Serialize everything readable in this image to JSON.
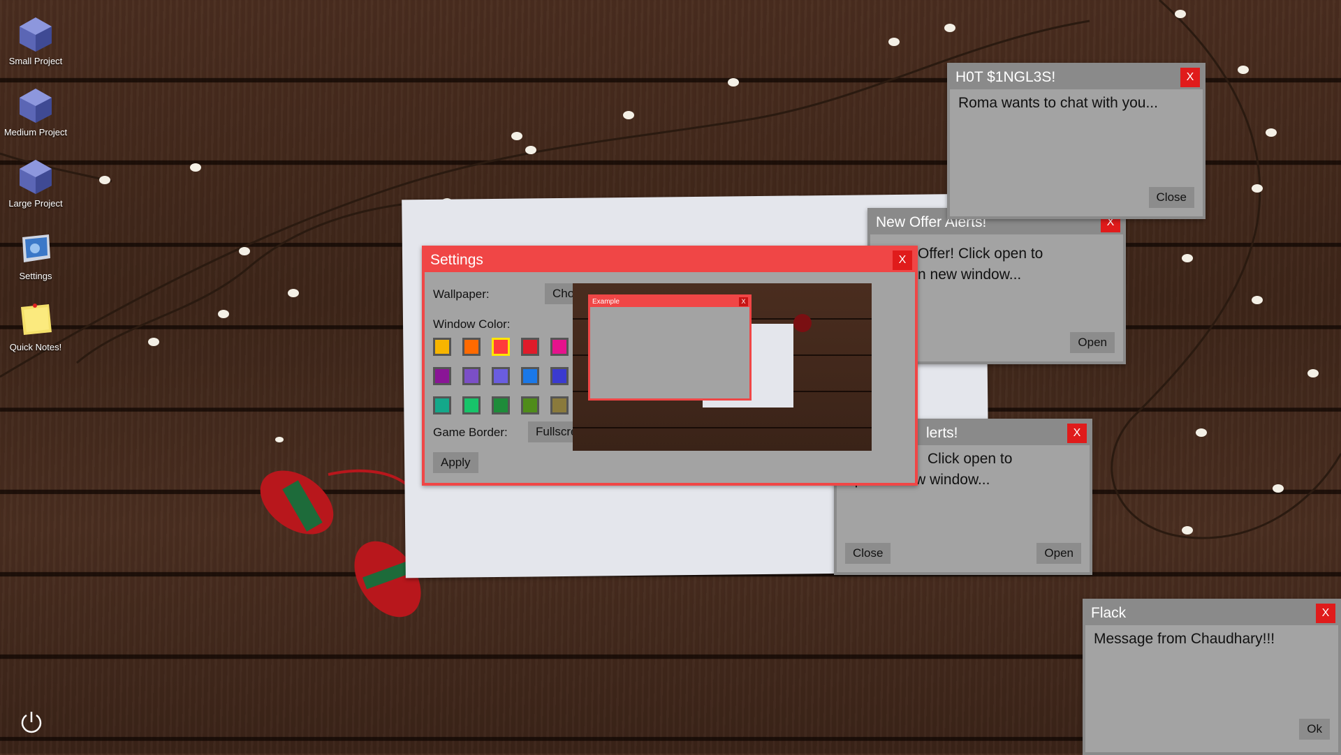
{
  "desktop": {
    "icons": [
      {
        "label": "Small Project",
        "icon": "cube-icon"
      },
      {
        "label": "Medium Project",
        "icon": "cube-icon"
      },
      {
        "label": "Large Project",
        "icon": "cube-icon"
      },
      {
        "label": "Settings",
        "icon": "settings-tablet-icon"
      },
      {
        "label": "Quick Notes!",
        "icon": "sticky-note-icon"
      }
    ],
    "power_icon": "power-icon"
  },
  "hot_singles": {
    "title": "H0T $1NGL3S!",
    "close_x": "X",
    "message": "Roma wants to chat with you...",
    "close_label": "Close"
  },
  "new_offer": {
    "title": "New Offer Alerts!",
    "close_x": "X",
    "message_line1": "Offer! Click open to",
    "message_line2": "n new window...",
    "open_label": "Open"
  },
  "alerts": {
    "title": "lerts!",
    "close_x": "X",
    "message_line1": "Click open to",
    "message_line2": "open in new window...",
    "close_label": "Close",
    "open_label": "Open"
  },
  "flack": {
    "title": "Flack",
    "close_x": "X",
    "message": "Message from Chaudhary!!!",
    "ok_label": "Ok"
  },
  "settings": {
    "title": "Settings",
    "close_x": "X",
    "wallpaper_label": "Wallpaper:",
    "choose_label": "Choose",
    "window_color_label": "Window Color:",
    "colors": [
      "#f7b500",
      "#ff6a00",
      "#ff3b3b",
      "#e01b2a",
      "#e6128c",
      "#c13bc4",
      "#8a1596",
      "#7b4fc7",
      "#6a5de0",
      "#1a78e8",
      "#3a3ad0",
      "#19bccb",
      "#14a88a",
      "#17c46a",
      "#1e8c3a",
      "#4f8c1a",
      "#8a7a3c",
      "#555555"
    ],
    "selected_color_index": 2,
    "game_border_label": "Game Border:",
    "fullscreen_label": "Fullscreen",
    "apply_label": "Apply",
    "preview": {
      "window_title": "Example",
      "close_x": "X"
    }
  }
}
